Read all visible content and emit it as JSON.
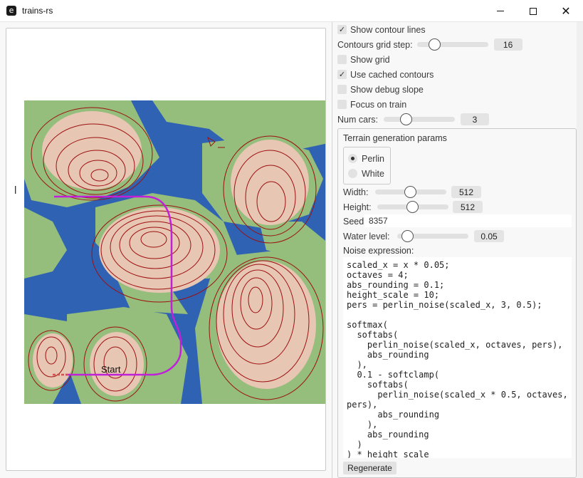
{
  "window": {
    "title": "trains-rs",
    "app_icon_glyph": "e"
  },
  "left_view": {
    "glyph": "l",
    "start_label": "Start"
  },
  "colors": {
    "water": "#2f62b3",
    "lowland": "#95bd7c",
    "highland": "#e7c6b3",
    "contour": "#9c1010",
    "track": "#c020d8",
    "track_start": "#d35050"
  },
  "settings": {
    "show_contour_lines": {
      "label": "Show contour lines",
      "checked": true
    },
    "contours_grid_step": {
      "label": "Contours grid step:",
      "value": "16",
      "fraction": 0.2
    },
    "show_grid": {
      "label": "Show grid",
      "checked": false
    },
    "use_cached_contours": {
      "label": "Use cached contours",
      "checked": true
    },
    "show_debug_slope": {
      "label": "Show debug slope",
      "checked": false
    },
    "focus_on_train": {
      "label": "Focus on train",
      "checked": false
    },
    "num_cars": {
      "label": "Num cars:",
      "value": "3",
      "fraction": 0.27
    }
  },
  "terrain": {
    "title": "Terrain generation params",
    "noise_type": {
      "options": [
        "Perlin",
        "White"
      ],
      "selected": "Perlin"
    },
    "width": {
      "label": "Width:",
      "value": "512",
      "fraction": 0.49
    },
    "height": {
      "label": "Height:",
      "value": "512",
      "fraction": 0.49
    },
    "seed": {
      "label": "Seed:",
      "value": "8357"
    },
    "water_level": {
      "label": "Water level:",
      "value": "0.05",
      "fraction": 0.07
    },
    "noise_expression": {
      "label": "Noise expression:",
      "code": "scaled_x = x * 0.05;\noctaves = 4;\nabs_rounding = 0.1;\nheight_scale = 10;\npers = perlin_noise(scaled_x, 3, 0.5);\n\nsoftmax(\n  softabs(\n    perlin_noise(scaled_x, octaves, pers),\n    abs_rounding\n  ),\n  0.1 - softclamp(\n    softabs(\n      perlin_noise(scaled_x * 0.5, octaves, pers),\n      abs_rounding\n    ),\n    abs_rounding\n  )\n) * height_scale"
    },
    "regenerate_label": "Regenerate"
  }
}
